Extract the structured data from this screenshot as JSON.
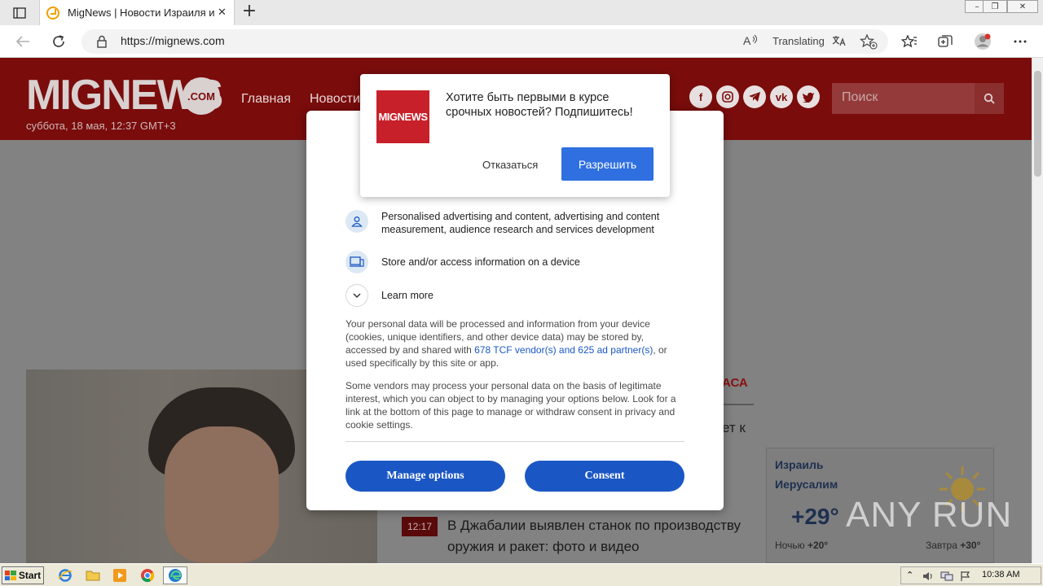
{
  "browser": {
    "tab": {
      "title": "MigNews | Новости Израиля и М",
      "close": "✕"
    },
    "new_tab": "+",
    "url": "https://mignews.com",
    "translating": "Translating",
    "window_controls": {
      "minimize": "–",
      "restore": "❐",
      "close": "✕"
    }
  },
  "site": {
    "logo": "MIGNEWS",
    "logo_suffix": ".COM",
    "date": "суббота, 18 мая, 12:37 GMT+3",
    "nav": [
      "Главная",
      "Новости"
    ],
    "social": [
      "f",
      "ig",
      "tg",
      "vk",
      "tw"
    ],
    "search_placeholder": "Поиск"
  },
  "page": {
    "news_heading_partial": "АСА",
    "news_snippet_partial": "ет к",
    "news_item": {
      "time": "12:17",
      "title": "В Джабалии выявлен станок по производству оружия и ракет: фото и видео"
    },
    "weather": {
      "country": "Израиль",
      "city": "Иерусалим",
      "temp": "+29°",
      "night_label": "Ночью",
      "night_temp": "+20°",
      "tomorrow_label": "Завтра",
      "tomorrow_temp": "+30°"
    },
    "watermark": "ANY RUN"
  },
  "consent": {
    "purposes": [
      {
        "icon": "person-icon",
        "text": "Personalised advertising and content, advertising and content measurement, audience research and services development"
      },
      {
        "icon": "device-icon",
        "text": "Store and/or access information on a device"
      }
    ],
    "learn_more": "Learn more",
    "para1_before": "Your personal data will be processed and information from your device (cookies, unique identifiers, and other device data) may be stored by, accessed by and shared with ",
    "para1_link": "678 TCF vendor(s) and 625 ad partner(s)",
    "para1_after": ", or used specifically by this site or app.",
    "para2": "Some vendors may process your personal data on the basis of legitimate interest, which you can object to by managing your options below. Look for a link at the bottom of this page to manage or withdraw consent in privacy and cookie settings.",
    "manage_button": "Manage options",
    "consent_button": "Consent"
  },
  "push": {
    "logo": "MIGNEWS",
    "text": "Хотите быть первыми в курсе срочных новостей? Подпишитесь!",
    "deny": "Отказаться",
    "allow": "Разрешить"
  },
  "taskbar": {
    "start": "Start",
    "apps": [
      "ie-icon",
      "folder-icon",
      "media-player-icon",
      "chrome-icon",
      "edge-icon"
    ],
    "clock": "10:38 AM"
  },
  "colors": {
    "brand_red": "#7a0c0c",
    "consent_blue": "#1a57c4",
    "push_blue": "#2f6fe0"
  }
}
